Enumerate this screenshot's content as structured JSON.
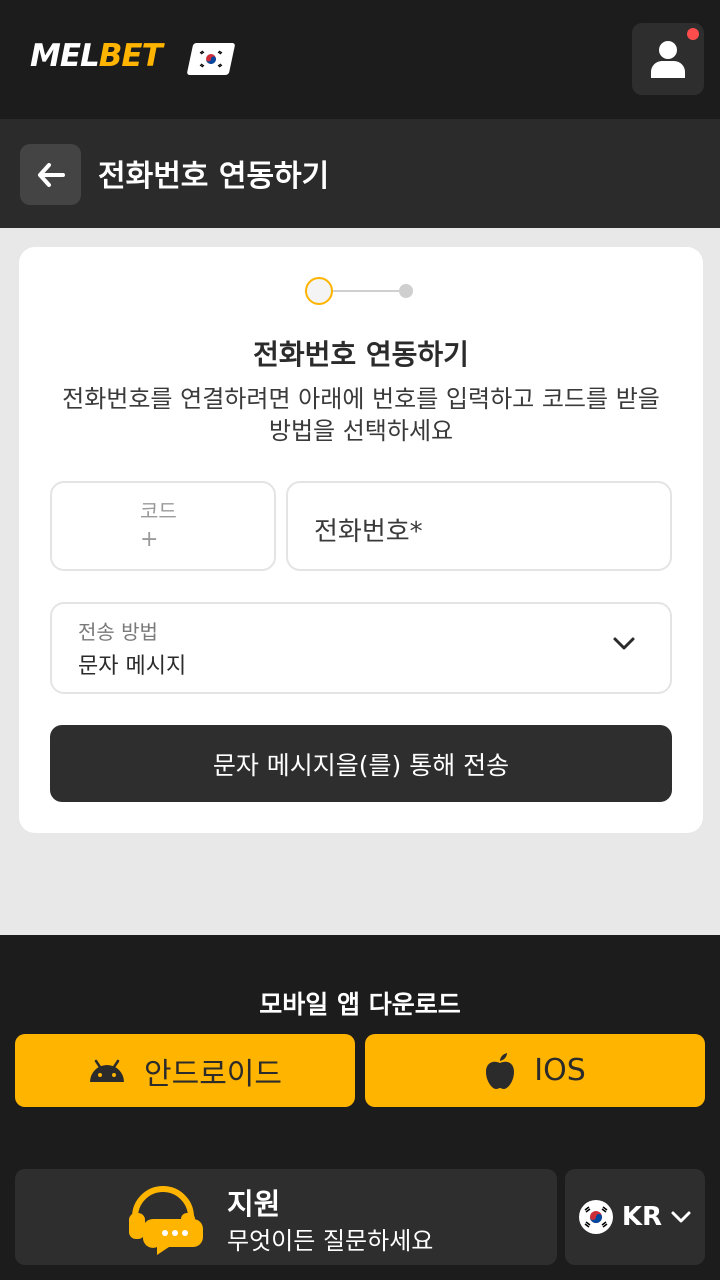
{
  "header": {
    "logo_mel": "MEL",
    "logo_bet": "BET",
    "flag_icon": "kr-flag-icon",
    "user_icon": "user-icon"
  },
  "subbar": {
    "title": "전화번호 연동하기",
    "back_icon": "arrow-left-icon"
  },
  "card": {
    "title": "전화번호 연동하기",
    "description": "전화번호를 연결하려면 아래에 번호를 입력하고 코드를 받을 방법을 선택하세요",
    "code_label": "코드",
    "code_value": "+",
    "phone_label": "전화번호*",
    "method_label": "전송 방법",
    "method_value": "문자 메시지",
    "send_button": "문자 메시지을(를) 통해 전송"
  },
  "footer": {
    "download_title": "모바일 앱 다운로드",
    "android_label": "안드로이드",
    "ios_label": "IOS",
    "support_title": "지원",
    "support_subtitle": "무엇이든 질문하세요",
    "language": "KR"
  },
  "colors": {
    "accent": "#ffb400",
    "dark": "#1c1c1c",
    "notification": "#ff4d4d"
  }
}
